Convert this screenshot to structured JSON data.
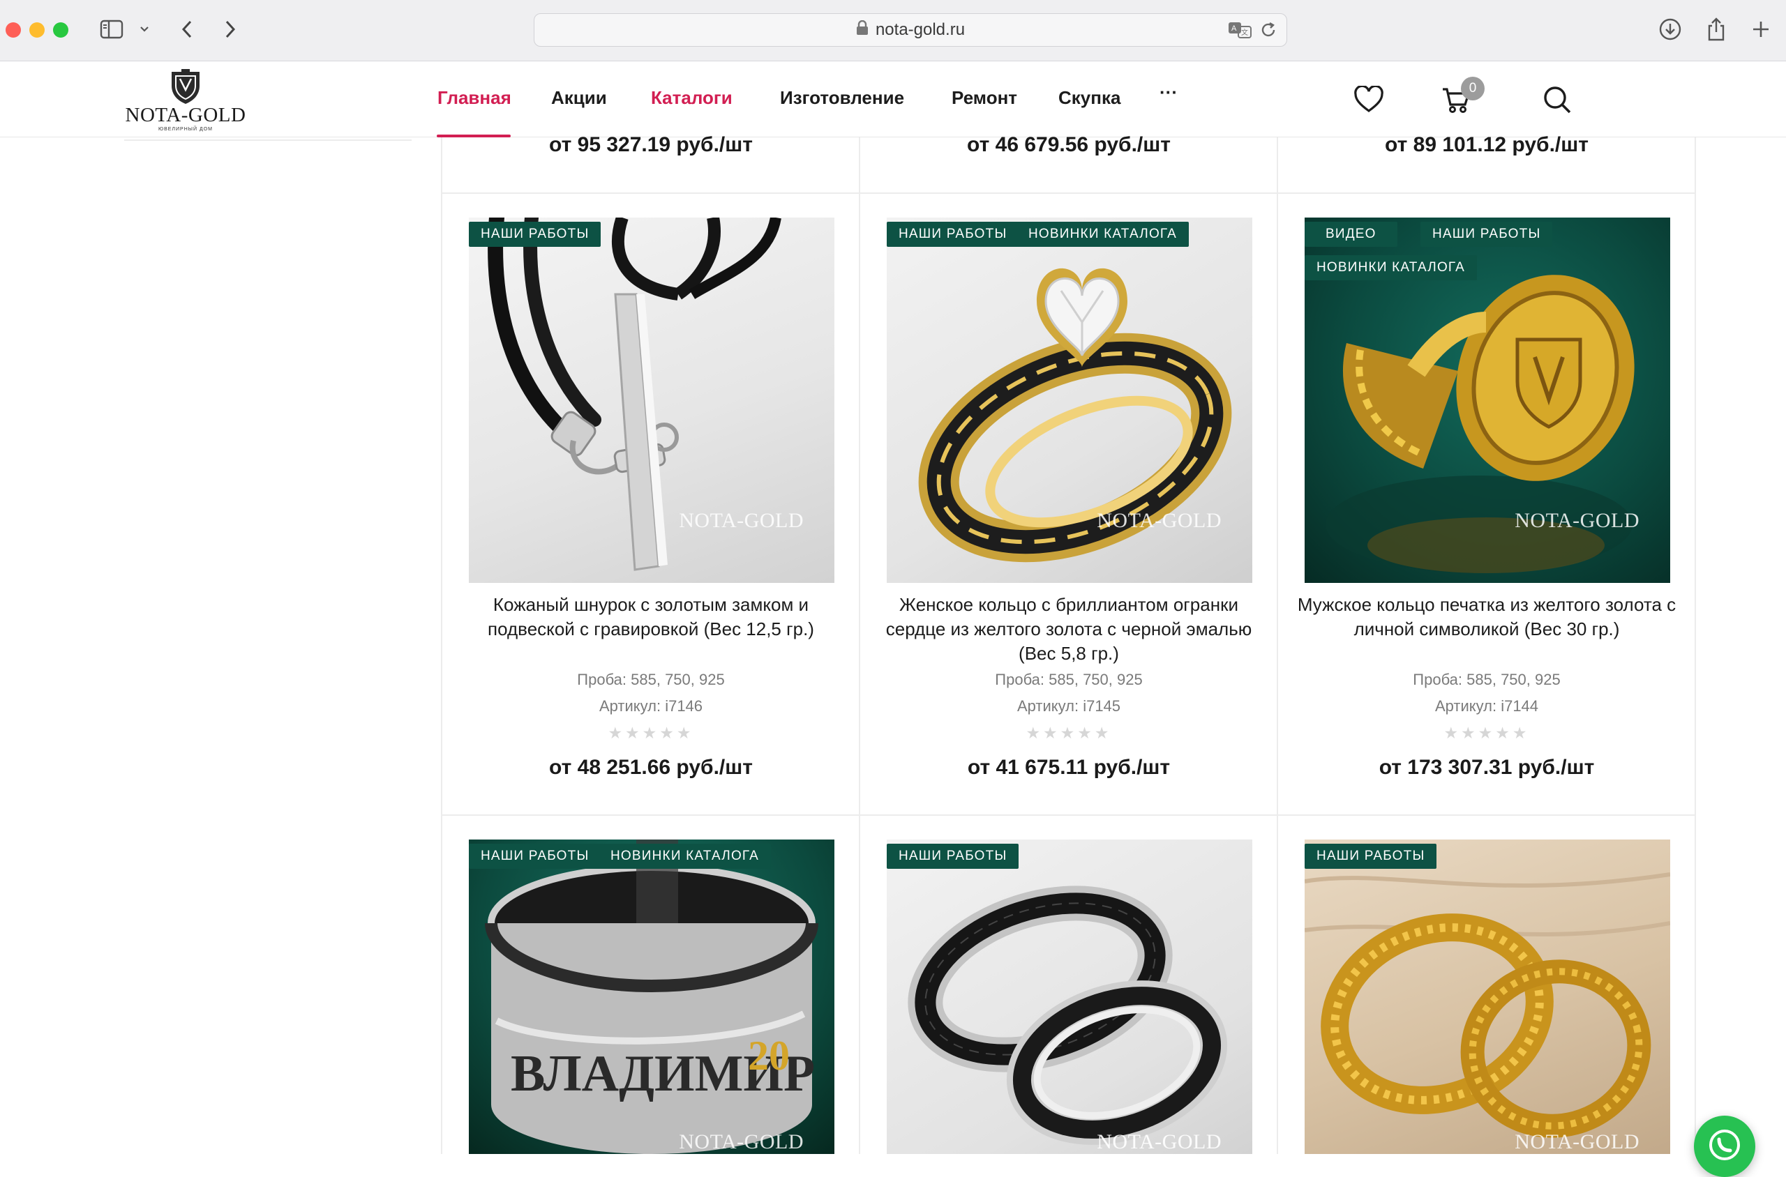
{
  "browser": {
    "url": "nota-gold.ru",
    "traffic_colors": [
      "#fe5f57",
      "#febc2e",
      "#28c840"
    ]
  },
  "header": {
    "logo_text": "NOTA-GOLD",
    "logo_sub": "ЮВЕЛИРНЫЙ ДОМ",
    "nav": [
      {
        "label": "Главная",
        "active": true
      },
      {
        "label": "Акции",
        "active": false
      },
      {
        "label": "Каталоги",
        "active": true
      },
      {
        "label": "Изготовление",
        "active": false
      },
      {
        "label": "Ремонт",
        "active": false
      },
      {
        "label": "Скупка",
        "active": false
      }
    ],
    "more_label": "···",
    "cart_count": "0",
    "accent": "#d21e52"
  },
  "top_prices": [
    "от 95 327.19 руб./шт",
    "от 46 679.56 руб./шт",
    "от 89 101.12 руб./шт"
  ],
  "products": [
    {
      "badges": [
        "НАШИ РАБОТЫ"
      ],
      "title": "Кожаный шнурок с золотым замком и подвеской с гравировкой (Вес 12,5 гр.)",
      "proba": "Проба: 585, 750, 925",
      "sku": "Артикул: i7146",
      "rating": "★★★★★",
      "price": "от 48 251.66 руб./шт",
      "watermark": "NOTA-GOLD"
    },
    {
      "badges": [
        "НАШИ РАБОТЫ",
        "НОВИНКИ КАТАЛОГА"
      ],
      "title": "Женское кольцо с бриллиантом огранки сердце из желтого золота с черной эмалью (Вес 5,8 гр.)",
      "proba": "Проба: 585, 750, 925",
      "sku": "Артикул: i7145",
      "rating": "★★★★★",
      "price": "от 41 675.11 руб./шт",
      "watermark": "NOTA-GOLD"
    },
    {
      "badges": [
        "ВИДЕО",
        "НАШИ РАБОТЫ",
        "НОВИНКИ КАТАЛОГА"
      ],
      "title": "Мужское кольцо печатка из желтого золота с личной символикой (Вес 30 гр.)",
      "proba": "Проба: 585, 750, 925",
      "sku": "Артикул: i7144",
      "rating": "★★★★★",
      "price": "от 173 307.31 руб./шт",
      "watermark": "NOTA-GOLD"
    },
    {
      "badges": [
        "НАШИ РАБОТЫ",
        "НОВИНКИ КАТАЛОГА"
      ],
      "engraving": "ВЛАДИМИР",
      "engraving_num": "20",
      "watermark": "NOTA-GOLD"
    },
    {
      "badges": [
        "НАШИ РАБОТЫ"
      ],
      "watermark": "NOTA-GOLD"
    },
    {
      "badges": [
        "НАШИ РАБОТЫ"
      ],
      "watermark": "NOTA-GOLD"
    }
  ],
  "badge_color": "#0d5244",
  "whatsapp_color": "#27c152"
}
